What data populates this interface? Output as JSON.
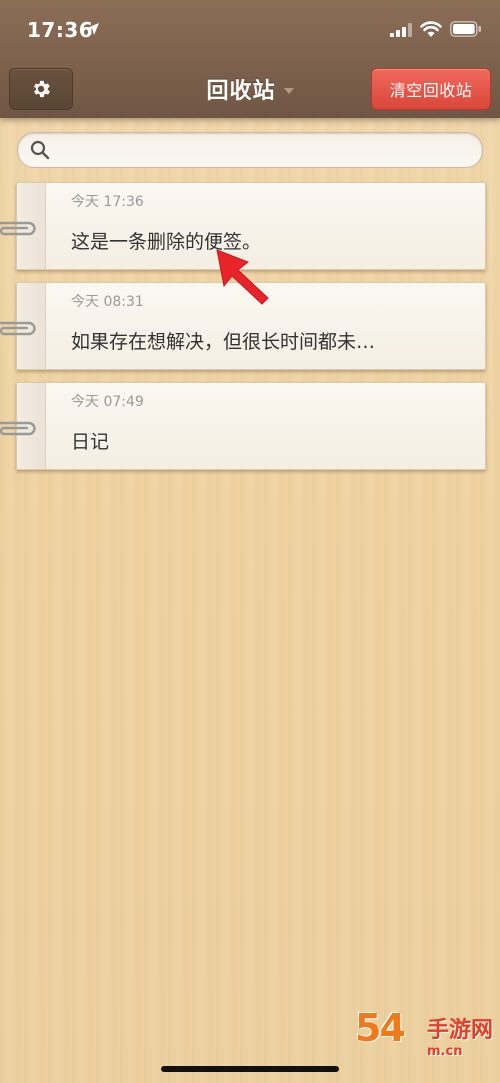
{
  "status_bar": {
    "time": "17:36"
  },
  "nav": {
    "title": "回收站",
    "clear_label": "清空回收站"
  },
  "search": {
    "placeholder": "",
    "value": ""
  },
  "notes": [
    {
      "date": "今天 17:36",
      "text": "这是一条删除的便签。"
    },
    {
      "date": "今天 08:31",
      "text": "如果存在想解决，但很长时间都未…"
    },
    {
      "date": "今天 07:49",
      "text": "日记"
    }
  ],
  "colors": {
    "header_bg": "#7b604c",
    "clear_button": "#e0554a",
    "annotation_arrow": "#e8232a",
    "watermark_orange": "#f07a1a",
    "watermark_red": "#e0402a"
  },
  "icons": {
    "settings": "gear-icon",
    "search": "search-icon",
    "note_clip": "paperclip-icon",
    "title_dropdown": "caret-down-icon"
  },
  "watermark": {
    "main": "54",
    "cn": "手游网",
    "url": "m.cn"
  }
}
